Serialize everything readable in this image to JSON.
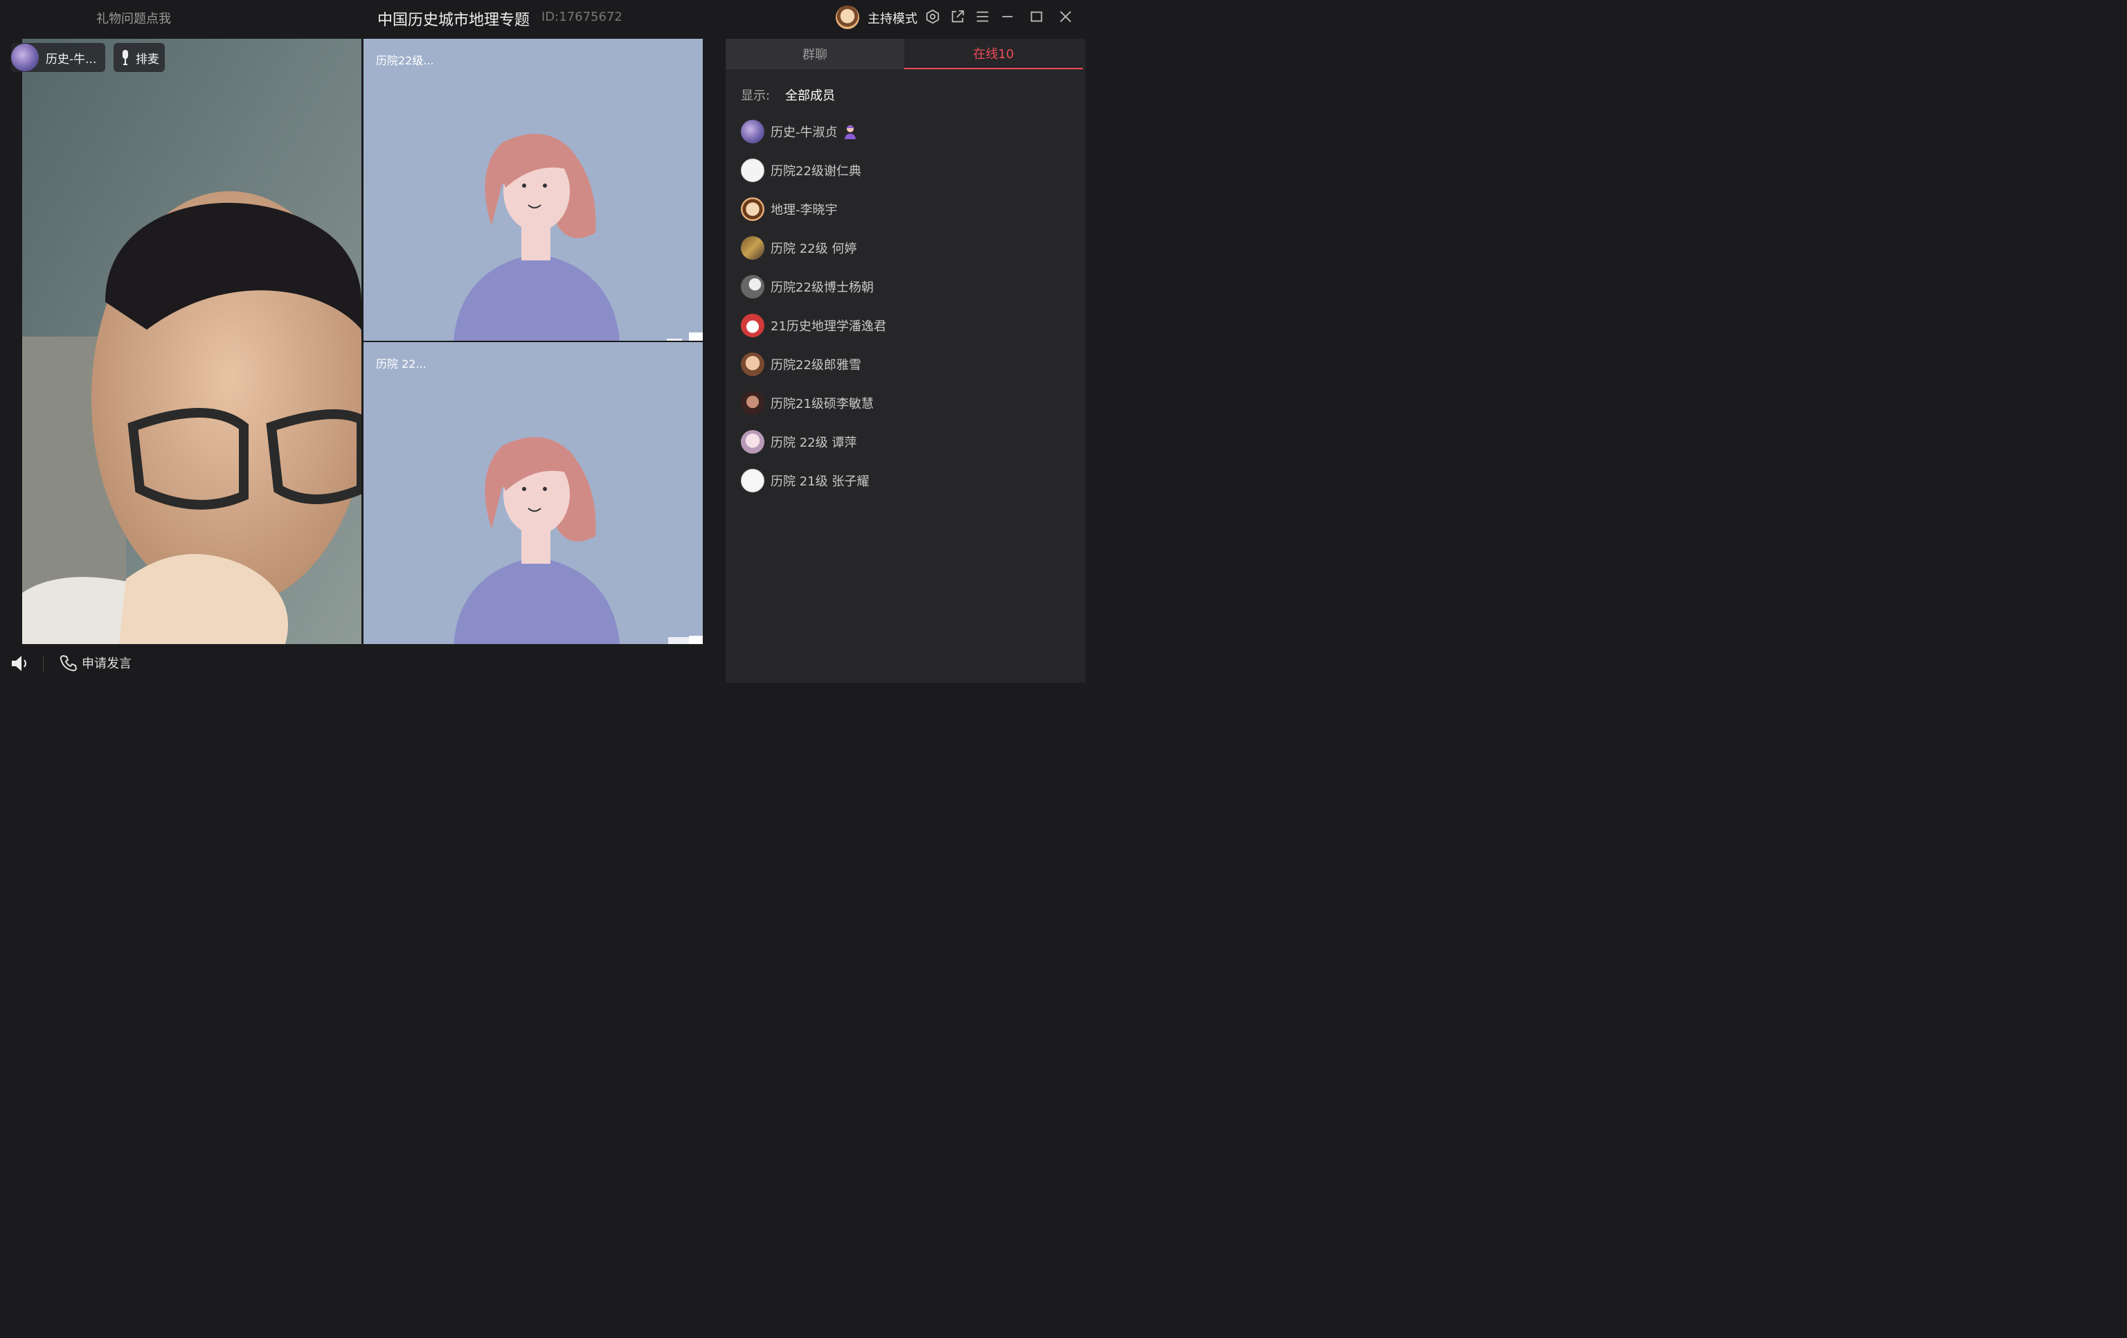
{
  "titlebar": {
    "gift_link": "礼物问题点我",
    "room_title": "中国历史城市地理专题",
    "room_id": "ID:17675672",
    "host_mode": "主持模式"
  },
  "main_video": {
    "name": "历史-牛...",
    "queue_mic": "排麦"
  },
  "tiles": [
    {
      "label": "历院22级..."
    },
    {
      "label": "历院 22..."
    }
  ],
  "bottombar": {
    "apply_speak": "申请发言"
  },
  "panel": {
    "tab_chat": "群聊",
    "tab_online": "在线10",
    "filter_label": "显示:",
    "filter_value": "全部成员",
    "members": [
      {
        "name": "历史-牛淑贞"
      },
      {
        "name": "历院22级谢仁典"
      },
      {
        "name": "地理-李晓宇"
      },
      {
        "name": "历院 22级 何婷"
      },
      {
        "name": "历院22级博士杨朝"
      },
      {
        "name": "21历史地理学潘逸君"
      },
      {
        "name": "历院22级郎雅雪"
      },
      {
        "name": "历院21级硕李敏慧"
      },
      {
        "name": "历院 22级 谭萍"
      },
      {
        "name": "历院 21级 张子耀"
      }
    ]
  },
  "colors": {
    "accent": "#f04a5a",
    "background": "#1b1b1d",
    "panel": "#262628",
    "tile_bg": "#a1b1cc"
  }
}
